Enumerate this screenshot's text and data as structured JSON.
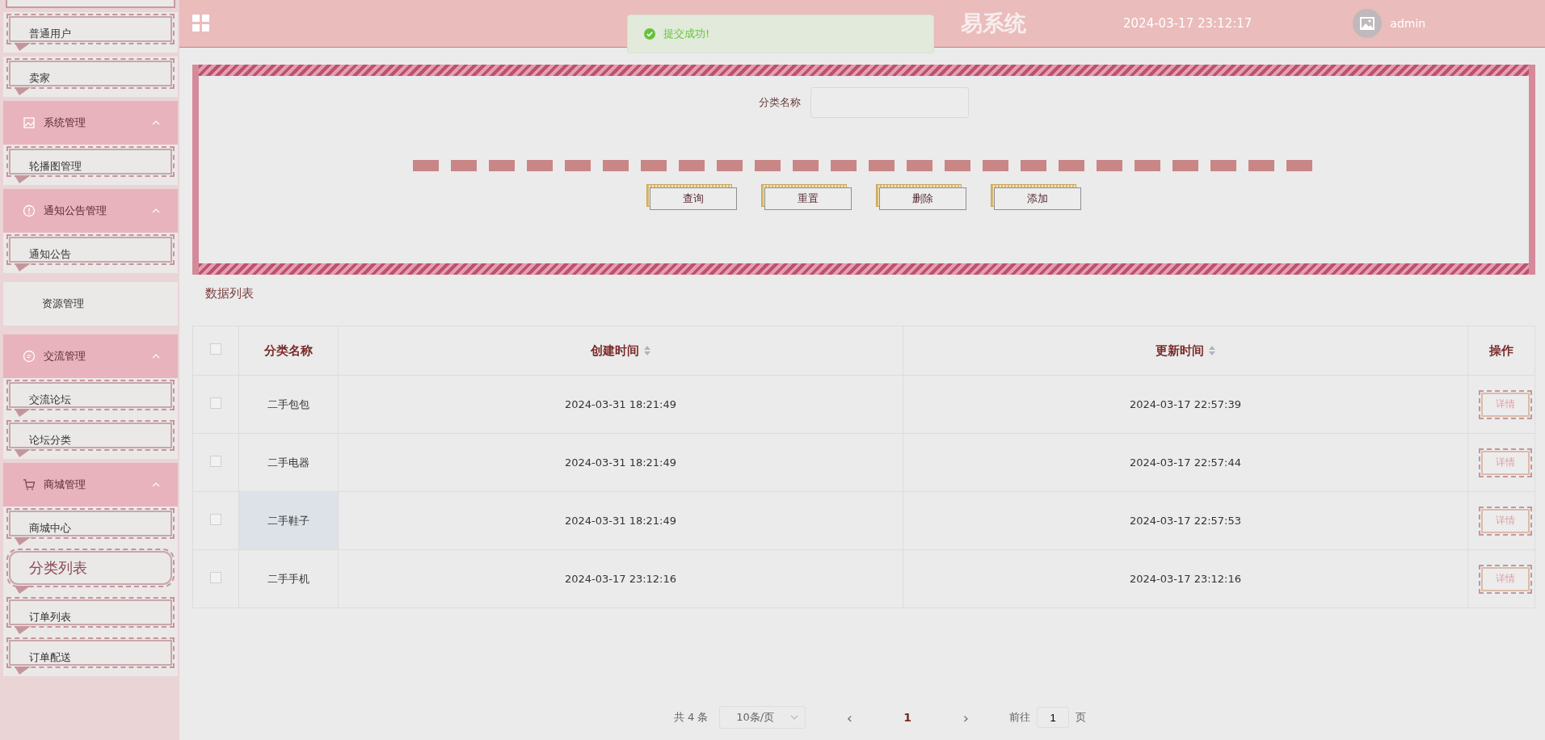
{
  "header": {
    "title_visible": "易系统",
    "datetime": "2024-03-17 23:12:17",
    "user": "admin"
  },
  "toast": {
    "message": "提交成功!"
  },
  "sidebar": {
    "items": [
      {
        "kind": "item",
        "label": "普通用户",
        "selected": false
      },
      {
        "kind": "item",
        "label": "卖家",
        "selected": false
      },
      {
        "kind": "group",
        "label": "系统管理",
        "expanded": true,
        "children": [
          {
            "kind": "item",
            "label": "轮播图管理",
            "selected": false
          }
        ]
      },
      {
        "kind": "group",
        "label": "通知公告管理",
        "expanded": true,
        "children": [
          {
            "kind": "item",
            "label": "通知公告",
            "selected": false
          }
        ]
      },
      {
        "kind": "plain",
        "label": "资源管理",
        "selected": false
      },
      {
        "kind": "group",
        "label": "交流管理",
        "expanded": true,
        "children": [
          {
            "kind": "item",
            "label": "交流论坛",
            "selected": false
          },
          {
            "kind": "item",
            "label": "论坛分类",
            "selected": false
          }
        ]
      },
      {
        "kind": "group",
        "label": "商城管理",
        "expanded": true,
        "children": [
          {
            "kind": "item",
            "label": "商城中心",
            "selected": false
          },
          {
            "kind": "item",
            "label": "分类列表",
            "selected": true
          },
          {
            "kind": "item",
            "label": "订单列表",
            "selected": false
          },
          {
            "kind": "item",
            "label": "订单配送",
            "selected": false
          }
        ]
      }
    ]
  },
  "search": {
    "label": "分类名称",
    "buttons": [
      "查询",
      "重置",
      "删除",
      "添加"
    ]
  },
  "list_title": "数据列表",
  "table": {
    "all_checked": false,
    "columns": [
      {
        "label": "分类名称",
        "sortable": false
      },
      {
        "label": "创建时间",
        "sortable": true
      },
      {
        "label": "更新时间",
        "sortable": true
      },
      {
        "label": "操作",
        "sortable": false
      }
    ],
    "rows": [
      {
        "checked": false,
        "hovered": false,
        "cells": [
          "二手包包",
          "2024-03-31 18:21:49",
          "2024-03-17 22:57:39"
        ],
        "action": "详情"
      },
      {
        "checked": false,
        "hovered": false,
        "cells": [
          "二手电器",
          "2024-03-31 18:21:49",
          "2024-03-17 22:57:44"
        ],
        "action": "详情"
      },
      {
        "checked": false,
        "hovered": true,
        "cells": [
          "二手鞋子",
          "2024-03-31 18:21:49",
          "2024-03-17 22:57:53"
        ],
        "action": "详情"
      },
      {
        "checked": false,
        "hovered": false,
        "cells": [
          "二手手机",
          "2024-03-17 23:12:16",
          "2024-03-17 23:12:16"
        ],
        "action": "详情"
      }
    ]
  },
  "pagination": {
    "total": "共 4 条",
    "page_size": "10条/页",
    "prev": "‹",
    "pages": [
      {
        "label": "1",
        "selected": true
      }
    ],
    "next": "›",
    "goto_label": "前往",
    "goto_value": "1",
    "page_suffix": "页"
  }
}
